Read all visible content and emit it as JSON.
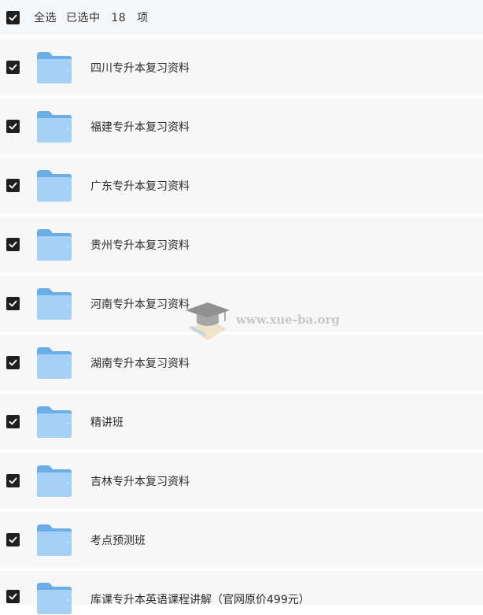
{
  "header": {
    "select_all_label": "全选",
    "selected_text": "已选中  18  项"
  },
  "folders": [
    {
      "name": "四川专升本复习资料"
    },
    {
      "name": "福建专升本复习资料"
    },
    {
      "name": "广东专升本复习资料"
    },
    {
      "name": "贵州专升本复习资料"
    },
    {
      "name": "河南专升本复习资料"
    },
    {
      "name": "湖南专升本复习资料"
    },
    {
      "name": "精讲班"
    },
    {
      "name": "吉林专升本复习资料"
    },
    {
      "name": "考点预测班"
    },
    {
      "name": "库课专升本英语课程讲解（官网原价499元）"
    }
  ],
  "watermark": {
    "text": "www.xue-ba.org"
  },
  "colors": {
    "checkbox": "#1f1f1f",
    "row_background": "#f7f7f8",
    "folder_front": "#a6d1f7",
    "folder_back": "#6aaee8"
  }
}
